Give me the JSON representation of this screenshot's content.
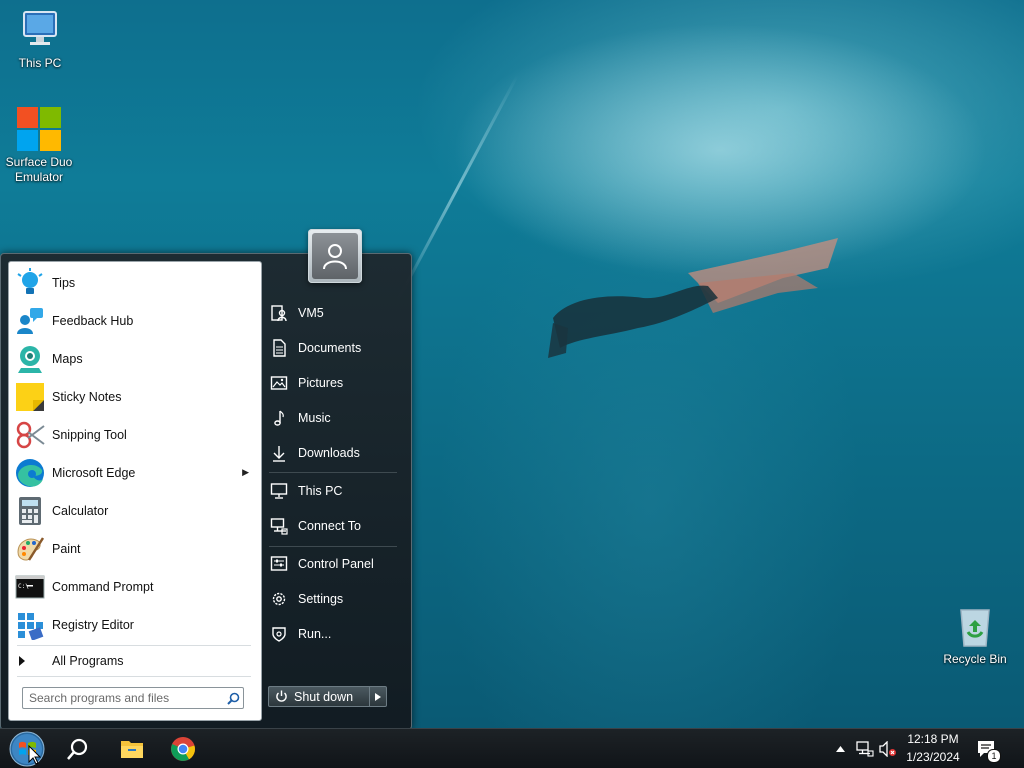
{
  "desktop": {
    "icons": [
      {
        "label": "This PC"
      },
      {
        "label": "Surface Duo Emulator"
      },
      {
        "label": "Recycle Bin"
      }
    ]
  },
  "start_menu": {
    "programs": [
      {
        "label": "Tips",
        "icon": "lightbulb-icon"
      },
      {
        "label": "Feedback Hub",
        "icon": "feedback-icon"
      },
      {
        "label": "Maps",
        "icon": "maps-icon"
      },
      {
        "label": "Sticky Notes",
        "icon": "sticky-notes-icon"
      },
      {
        "label": "Snipping Tool",
        "icon": "scissors-icon"
      },
      {
        "label": "Microsoft Edge",
        "icon": "edge-icon",
        "has_submenu": true
      },
      {
        "label": "Calculator",
        "icon": "calculator-icon"
      },
      {
        "label": "Paint",
        "icon": "paint-palette-icon"
      },
      {
        "label": "Command Prompt",
        "icon": "terminal-icon"
      },
      {
        "label": "Registry Editor",
        "icon": "registry-icon"
      }
    ],
    "all_programs": "All Programs",
    "search_placeholder": "Search programs and files",
    "right_items": [
      {
        "label": "VM5",
        "icon": "user-folder-icon"
      },
      {
        "label": "Documents",
        "icon": "document-icon"
      },
      {
        "label": "Pictures",
        "icon": "picture-icon"
      },
      {
        "label": "Music",
        "icon": "music-icon"
      },
      {
        "label": "Downloads",
        "icon": "download-icon"
      },
      {
        "label": "This PC",
        "icon": "computer-icon"
      },
      {
        "label": "Connect To",
        "icon": "network-icon"
      },
      {
        "label": "Control Panel",
        "icon": "control-panel-icon"
      },
      {
        "label": "Settings",
        "icon": "gear-icon"
      },
      {
        "label": "Run...",
        "icon": "run-icon"
      }
    ],
    "shutdown_label": "Shut down"
  },
  "taskbar": {
    "time": "12:18 PM",
    "date": "1/23/2024",
    "notification_count": "1"
  },
  "colors": {
    "accent_blue": "#1e90d6",
    "menu_dark": "#1b242a"
  }
}
